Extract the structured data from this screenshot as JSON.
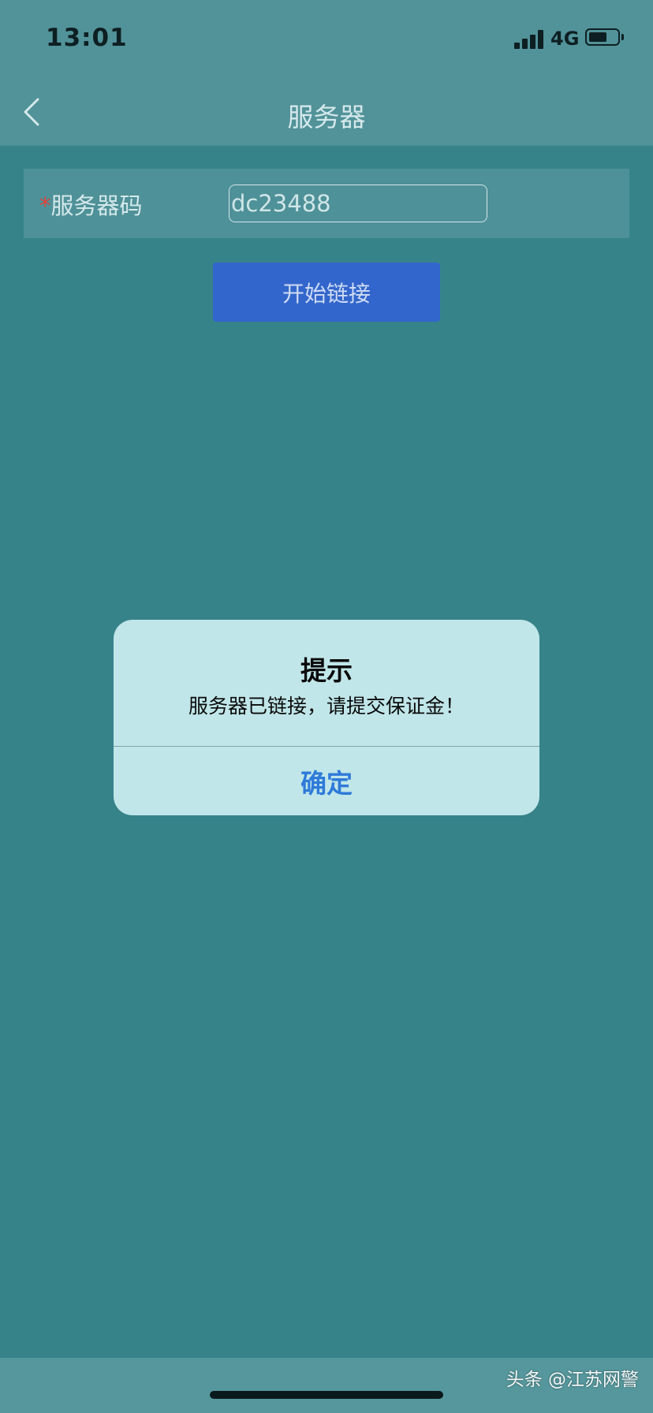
{
  "status_bar": {
    "time": "13:01",
    "network": "4G",
    "battery_level": 0.65,
    "signal_bars": 4
  },
  "nav": {
    "title": "服务器",
    "back_icon": "chevron-left-icon"
  },
  "form": {
    "required_mark": "*",
    "server_code_label": "服务器码",
    "server_code_value": "dc23488"
  },
  "connect_button": {
    "label": "开始链接"
  },
  "alert": {
    "title": "提示",
    "message": "服务器已链接，请提交保证金！",
    "ok_label": "确定"
  },
  "watermark": {
    "text": "头条 @江苏网警"
  },
  "colors": {
    "background": "#37838a",
    "bar": "#529299",
    "button": "#3366cc",
    "alert_bg": "#c0e6e9",
    "alert_action": "#2f7ad9",
    "required": "#d9443e"
  }
}
